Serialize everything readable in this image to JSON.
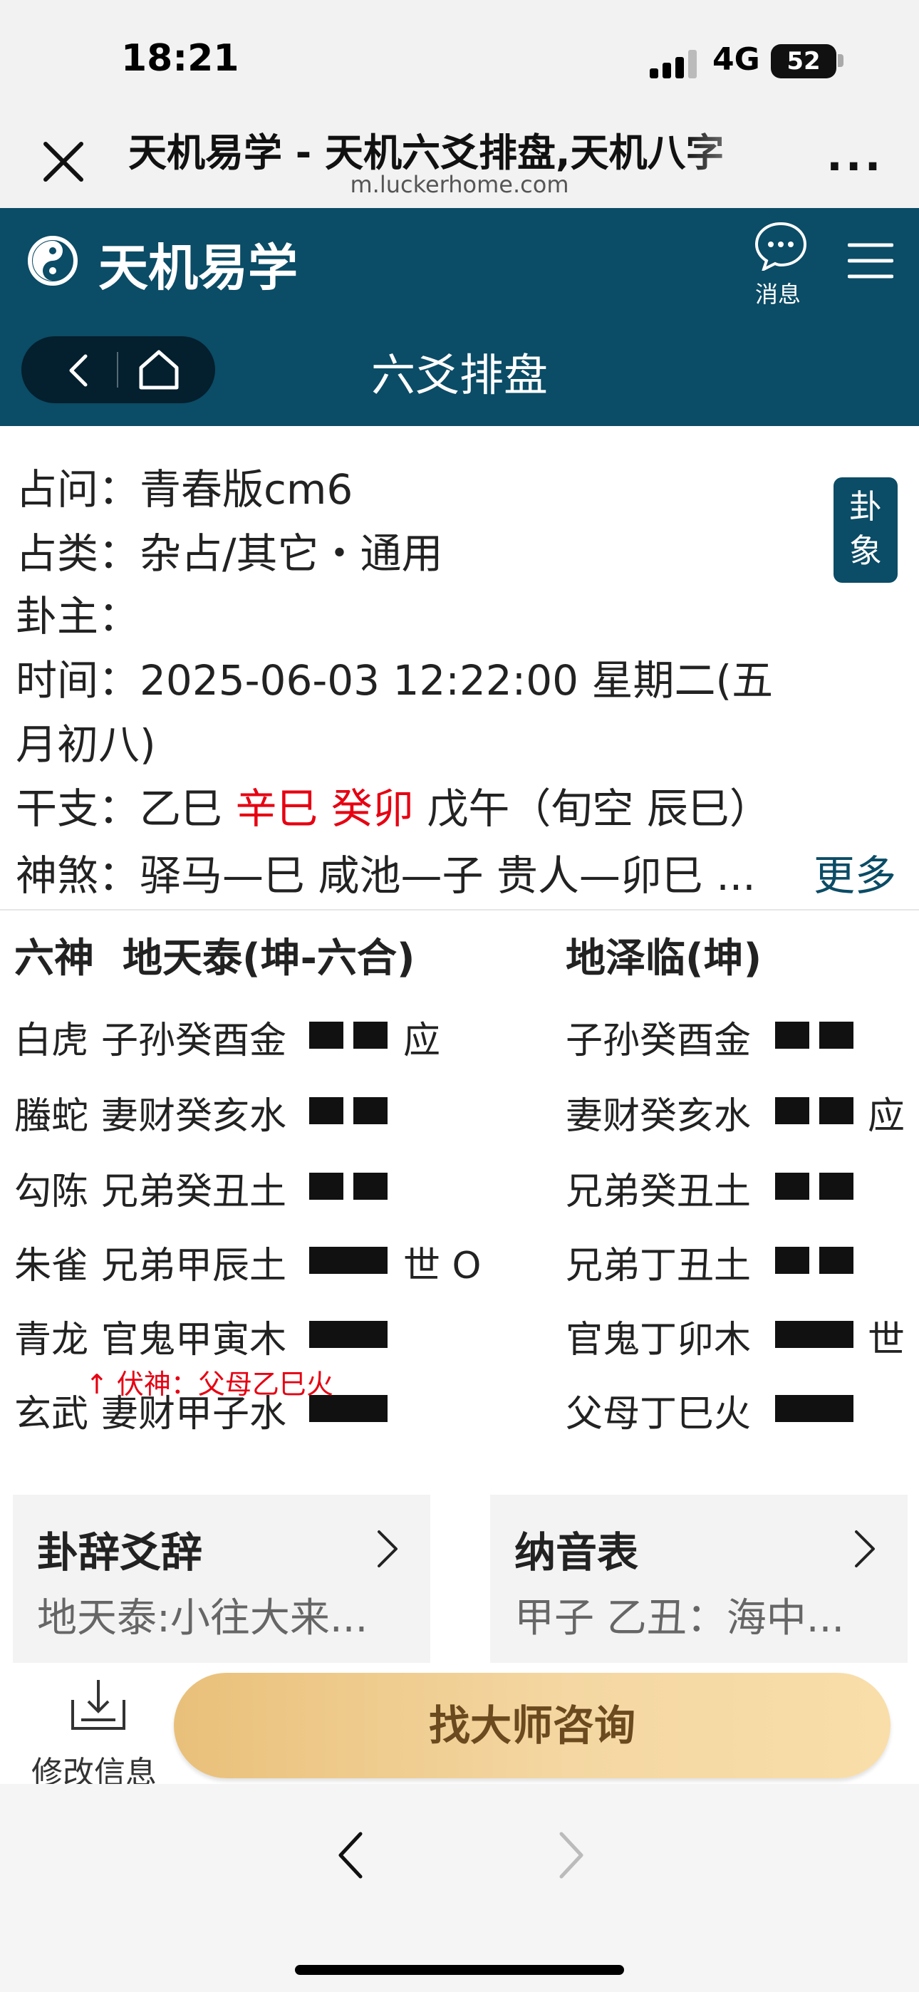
{
  "status_bar": {
    "time": "18:21",
    "network": "4G",
    "battery": "52"
  },
  "browser": {
    "title": "天机易学 - 天机六爻排盘,天机八字",
    "url": "m.luckerhome.com",
    "more": "..."
  },
  "header": {
    "logo_text": "天机易学",
    "message_label": "消息",
    "section_title": "六爻排盘"
  },
  "info": {
    "question_label": "占问：",
    "question": "青春版cm6",
    "category_label": "占类：",
    "category": "杂占/其它・通用",
    "owner_label": "卦主：",
    "time_label": "时间：",
    "time_line1": "2025-06-03 12:22:00   星期二(五",
    "time_line2": "月初八)",
    "ganzhi_label": "干支：",
    "gz_year": "乙巳",
    "gz_month": "辛巳",
    "gz_day": "癸卯",
    "gz_hour": "戊午",
    "xunkong": "（旬空   辰巳）",
    "shensha_label": "神煞：",
    "shensha": "驿马—巳  咸池—子  贵人—卯巳 ...",
    "more_link": "更多",
    "badge_line1": "卦",
    "badge_line2": "象"
  },
  "hexagram": {
    "liushen_header": "六神",
    "main_title": "地天泰(坤-六合)",
    "changed_title": "地泽临(坤)",
    "rows": [
      {
        "god": "白虎",
        "main": "子孙癸酉金",
        "main_line": "yin",
        "main_mark": "应",
        "changed": "子孙癸酉金",
        "changed_line": "yin",
        "changed_mark": ""
      },
      {
        "god": "螣蛇",
        "main": "妻财癸亥水",
        "main_line": "yin",
        "main_mark": "",
        "changed": "妻财癸亥水",
        "changed_line": "yin",
        "changed_mark": "应"
      },
      {
        "god": "勾陈",
        "main": "兄弟癸丑土",
        "main_line": "yin",
        "main_mark": "",
        "changed": "兄弟癸丑土",
        "changed_line": "yin",
        "changed_mark": ""
      },
      {
        "god": "朱雀",
        "main": "兄弟甲辰土",
        "main_line": "yang",
        "main_mark": "世 O",
        "changed": "兄弟丁丑土",
        "changed_line": "yin",
        "changed_mark": ""
      },
      {
        "god": "青龙",
        "main": "官鬼甲寅木",
        "main_line": "yang",
        "main_mark": "",
        "changed": "官鬼丁卯木",
        "changed_line": "yang",
        "changed_mark": "世"
      },
      {
        "god": "玄武",
        "main": "妻财甲子水",
        "main_line": "yang",
        "main_mark": "",
        "changed": "父母丁巳火",
        "changed_line": "yang",
        "changed_mark": ""
      }
    ],
    "fushen_note": "↑ 伏神：父母乙巳火"
  },
  "cards": {
    "left": {
      "title": "卦辞爻辞",
      "subtitle": "地天泰:小往大来..."
    },
    "right": {
      "title": "纳音表",
      "subtitle": "甲子 乙丑：海中..."
    }
  },
  "actions": {
    "edit_label": "修改信息",
    "consult_label": "找大师咨询"
  },
  "colors": {
    "header_bg": "#0b4c66",
    "accent_red": "#e60012",
    "gold": "#f4d7a2"
  }
}
